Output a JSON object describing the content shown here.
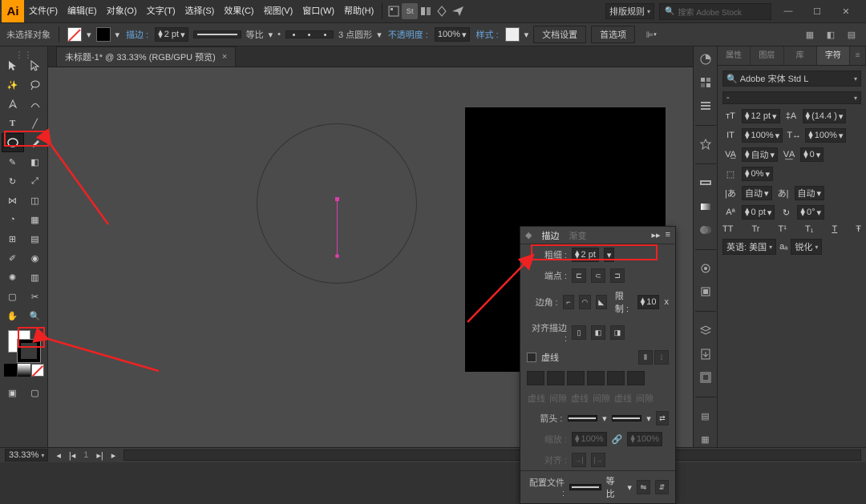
{
  "app": {
    "logo": "Ai"
  },
  "menu": [
    "文件(F)",
    "编辑(E)",
    "对象(O)",
    "文字(T)",
    "选择(S)",
    "效果(C)",
    "视图(V)",
    "窗口(W)",
    "帮助(H)"
  ],
  "topbar": {
    "layout_label": "排版规则",
    "search_placeholder": "搜索 Adobe Stock"
  },
  "options": {
    "no_selection": "未选择对象",
    "stroke_label": "描边 :",
    "stroke_weight": "2 pt",
    "uniform": "等比",
    "brush": "3 点圆形",
    "opacity_label": "不透明度 :",
    "opacity": "100%",
    "style_label": "样式 :",
    "doc_setup": "文档设置",
    "prefs": "首选项"
  },
  "tab": {
    "title": "未标题-1* @ 33.33% (RGB/GPU 预览)",
    "close": "×"
  },
  "status": {
    "zoom": "33.33%",
    "tool": "椭圆"
  },
  "char_panel": {
    "tabs": [
      "属性",
      "图层",
      "库",
      "字符"
    ],
    "active_tab": 3,
    "font": "Adobe 宋体 Std L",
    "style": "-",
    "size": "12 pt",
    "leading": "(14.4 )",
    "hscale": "100%",
    "vscale": "100%",
    "kerning": "自动",
    "tracking": "0",
    "opacity": "0%",
    "auto": "自动",
    "baseline": "0 pt",
    "rotate": "0°",
    "tt": "TT",
    "tr": "Tr",
    "tsup": "T¹",
    "tsub": "T₁",
    "tst": "T",
    "tstr": "Ŧ",
    "lang": "英语: 美国",
    "aa": "aₐ",
    "sharp": "锐化"
  },
  "stroke_panel": {
    "tab_stroke": "描边",
    "tab_grad": "渐变",
    "weight_label": "粗细 :",
    "weight": "2 pt",
    "cap_label": "端点 :",
    "corner_label": "边角 :",
    "limit_label": "限制 :",
    "limit": "10",
    "x": "x",
    "align_label": "对齐描边 :",
    "dashed": "虚线",
    "dash_labels": [
      "虚线",
      "间隙",
      "虚线",
      "间隙",
      "虚线",
      "间隙"
    ],
    "arrow_label": "箭头 :",
    "scale_label": "缩放 :",
    "scale1": "100%",
    "scale2": "100%",
    "alignopt": "对齐 :",
    "profile_label": "配置文件 :",
    "profile": "等比"
  }
}
